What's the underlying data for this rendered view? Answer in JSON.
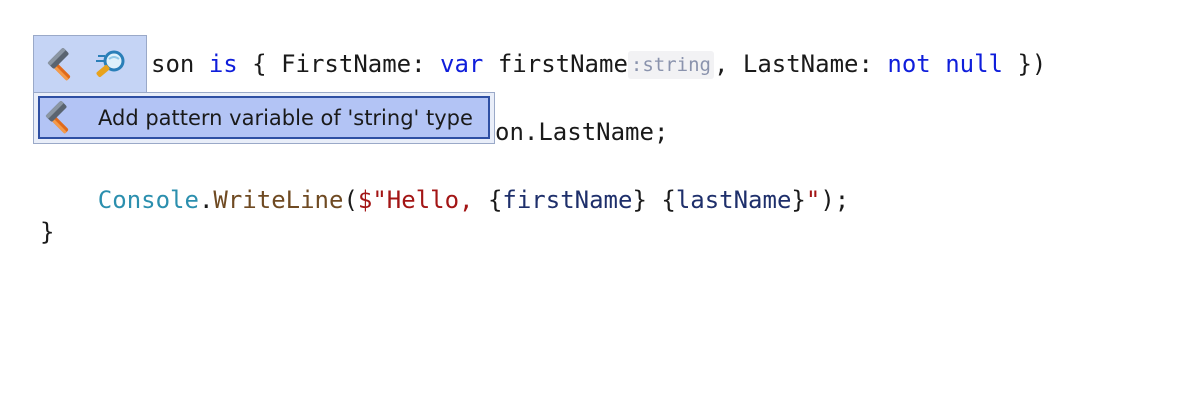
{
  "code": {
    "line1": {
      "tail_ident": "son",
      "kw_is": "is",
      "brace_open": "{",
      "prop_first": "FirstName:",
      "kw_var": "var",
      "var_first": "firstName",
      "type_hint": ":string",
      "comma": ",",
      "prop_last": "LastName:",
      "kw_not": "not",
      "kw_null": "null",
      "close": "})"
    },
    "line2": {
      "visible_tail": "on.LastName;"
    },
    "line3": {
      "indent": "    ",
      "class_name": "Console",
      "dot": ".",
      "method_name": "WriteLine",
      "paren_open": "(",
      "str_start": "$\"Hello, ",
      "interp1_open": "{",
      "interp1_var": "firstName",
      "interp1_close": "}",
      "space": " ",
      "interp2_open": "{",
      "interp2_var": "lastName",
      "interp2_close": "}",
      "str_end": "\"",
      "paren_close": ");"
    },
    "line4": {
      "brace_close": "}"
    }
  },
  "action_bar": {
    "icons": [
      "hammer-icon",
      "inspect-icon"
    ]
  },
  "popup_menu": {
    "items": [
      {
        "icon": "hammer-icon",
        "label": "Add pattern variable of 'string' type"
      }
    ]
  },
  "colors": {
    "keyword": "#0f1edb",
    "class": "#2b8fae",
    "method": "#6f4a22",
    "string": "#a31515",
    "local": "#1e2f6b",
    "hint_text": "#8a93ad",
    "menu_selected_bg": "#b3c4f5",
    "menu_selected_border": "#2e4fa3"
  }
}
